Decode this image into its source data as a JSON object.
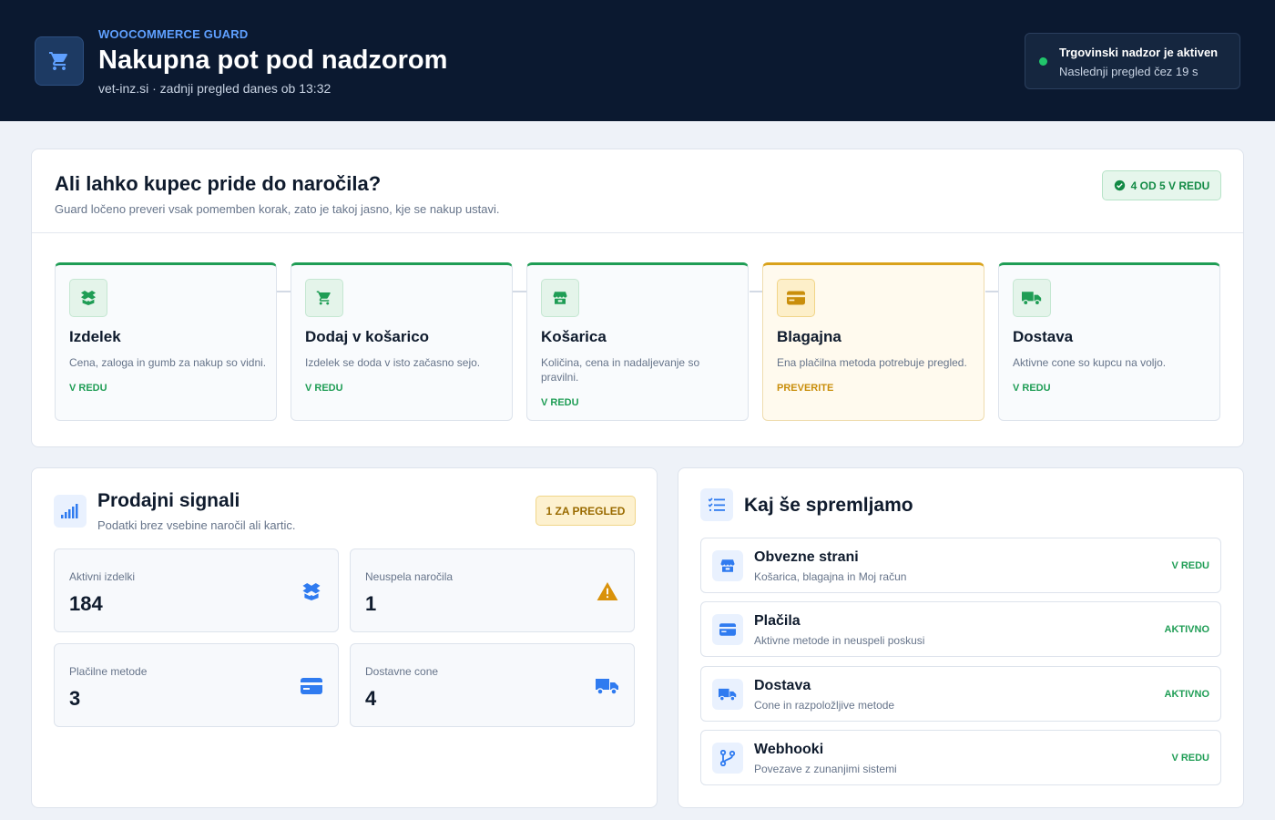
{
  "header": {
    "brand": "WOOCOMMERCE GUARD",
    "title": "Nakupna pot pod nadzorom",
    "subtitle": "vet-inz.si · zadnji pregled danes ob 13:32",
    "logo_icon": "cart-icon",
    "status_title": "Trgovinski nadzor je aktiven",
    "status_sub": "Naslednji pregled čez 19 s",
    "status_color": "#21c56b"
  },
  "journey": {
    "title": "Ali lahko kupec pride do naročila?",
    "subtitle": "Guard ločeno preveri vsak pomemben korak, zato je takoj jasno, kje se nakup ustavi.",
    "badge": "4 OD 5 V REDU",
    "steps": [
      {
        "name": "Izdelek",
        "desc": "Cena, zaloga in gumb za nakup so vidni.",
        "status": "V REDU",
        "icon": "box-icon"
      },
      {
        "name": "Dodaj v košarico",
        "desc": "Izdelek se doda v isto začasno sejo.",
        "status": "V REDU",
        "icon": "cart-icon"
      },
      {
        "name": "Košarica",
        "desc": "Količina, cena in nadaljevanje so pravilni.",
        "status": "V REDU",
        "icon": "store-icon"
      },
      {
        "name": "Blagajna",
        "desc": "Ena plačilna metoda potrebuje pregled.",
        "status": "PREVERITE",
        "icon": "card-icon"
      },
      {
        "name": "Dostava",
        "desc": "Aktivne cone so kupcu na voljo.",
        "status": "V REDU",
        "icon": "truck-icon"
      }
    ]
  },
  "signals": {
    "title": "Prodajni signali",
    "subtitle": "Podatki brez vsebine naročil ali kartic.",
    "badge": "1 ZA PREGLED",
    "metrics": [
      {
        "label": "Aktivni izdelki",
        "value": "184",
        "icon": "box-icon"
      },
      {
        "label": "Neuspela naročila",
        "value": "1",
        "icon": "warning-icon"
      },
      {
        "label": "Plačilne metode",
        "value": "3",
        "icon": "card-icon"
      },
      {
        "label": "Dostavne cone",
        "value": "4",
        "icon": "truck-icon"
      }
    ]
  },
  "monitor": {
    "title": "Kaj še spremljamo",
    "items": [
      {
        "name": "Obvezne strani",
        "desc": "Košarica, blagajna in Moj račun",
        "status": "V REDU",
        "icon": "store-icon"
      },
      {
        "name": "Plačila",
        "desc": "Aktivne metode in neuspeli poskusi",
        "status": "AKTIVNO",
        "icon": "card-icon"
      },
      {
        "name": "Dostava",
        "desc": "Cone in razpoložljive metode",
        "status": "AKTIVNO",
        "icon": "truck-icon"
      },
      {
        "name": "Webhooki",
        "desc": "Povezave z zunanjimi sistemi",
        "status": "V REDU",
        "icon": "branch-icon"
      }
    ]
  },
  "colors": {
    "ok": "#1f9d55",
    "warn": "#d9a21b",
    "accent": "#2f7bf0",
    "header_bg": "#0b1930"
  }
}
